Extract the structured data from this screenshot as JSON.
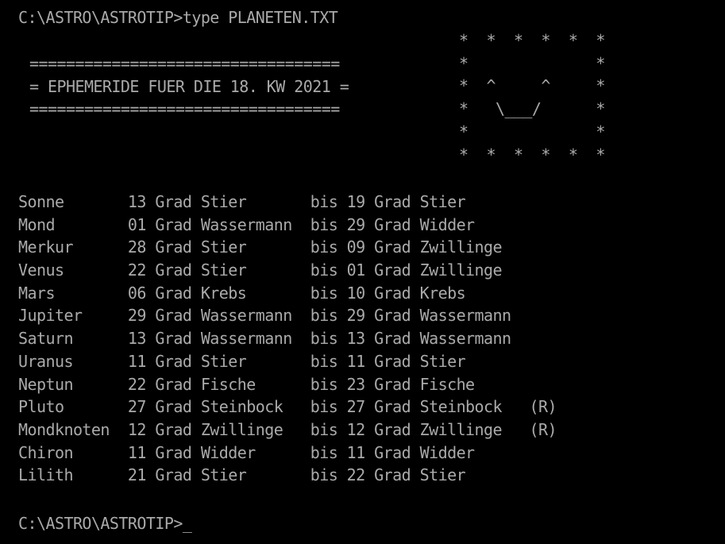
{
  "terminal": {
    "background_color": "#000000",
    "text_color": "#aaaaaa",
    "prompt_path": "C:\\ASTRO\\ASTROTIP>",
    "command_typed": "type PLANETEN.TXT",
    "command_line": "C:\\ASTRO\\ASTROTIP>type PLANETEN.TXT",
    "final_prompt": "C:\\ASTRO\\ASTROTIP>_",
    "cursor_glyph": "_"
  },
  "header": {
    "rule_top": "==================================",
    "title_line": "= EPHEMERIDE FUER DIE 18. KW 2021 =",
    "rule_bottom": "==================================",
    "title_text": "EPHEMERIDE FUER DIE 18. KW 2021",
    "calendar_week": "18",
    "year": "2021"
  },
  "ascii_art": {
    "name": "smiley-face-star-border",
    "lines": [
      "*  *  *  *  *  *",
      "*              *",
      "*  ^     ^     *",
      "*   \\___/      *",
      "*              *",
      "*  *  *  *  *  *"
    ],
    "eye_glyph": "^",
    "mouth_glyph": "\\___/",
    "star_glyph": "*"
  },
  "table": {
    "separator_word": "bis",
    "unit_word": "Grad",
    "retrograde_marker": "(R)",
    "rows": [
      {
        "body": "Sonne",
        "from_deg": "13",
        "from_unit": "Grad",
        "from_sign": "Stier",
        "sep": "bis",
        "to_deg": "19",
        "to_unit": "Grad",
        "to_sign": "Stier",
        "retro": ""
      },
      {
        "body": "Mond",
        "from_deg": "01",
        "from_unit": "Grad",
        "from_sign": "Wassermann",
        "sep": "bis",
        "to_deg": "29",
        "to_unit": "Grad",
        "to_sign": "Widder",
        "retro": ""
      },
      {
        "body": "Merkur",
        "from_deg": "28",
        "from_unit": "Grad",
        "from_sign": "Stier",
        "sep": "bis",
        "to_deg": "09",
        "to_unit": "Grad",
        "to_sign": "Zwillinge",
        "retro": ""
      },
      {
        "body": "Venus",
        "from_deg": "22",
        "from_unit": "Grad",
        "from_sign": "Stier",
        "sep": "bis",
        "to_deg": "01",
        "to_unit": "Grad",
        "to_sign": "Zwillinge",
        "retro": ""
      },
      {
        "body": "Mars",
        "from_deg": "06",
        "from_unit": "Grad",
        "from_sign": "Krebs",
        "sep": "bis",
        "to_deg": "10",
        "to_unit": "Grad",
        "to_sign": "Krebs",
        "retro": ""
      },
      {
        "body": "Jupiter",
        "from_deg": "29",
        "from_unit": "Grad",
        "from_sign": "Wassermann",
        "sep": "bis",
        "to_deg": "29",
        "to_unit": "Grad",
        "to_sign": "Wassermann",
        "retro": ""
      },
      {
        "body": "Saturn",
        "from_deg": "13",
        "from_unit": "Grad",
        "from_sign": "Wassermann",
        "sep": "bis",
        "to_deg": "13",
        "to_unit": "Grad",
        "to_sign": "Wassermann",
        "retro": ""
      },
      {
        "body": "Uranus",
        "from_deg": "11",
        "from_unit": "Grad",
        "from_sign": "Stier",
        "sep": "bis",
        "to_deg": "11",
        "to_unit": "Grad",
        "to_sign": "Stier",
        "retro": ""
      },
      {
        "body": "Neptun",
        "from_deg": "22",
        "from_unit": "Grad",
        "from_sign": "Fische",
        "sep": "bis",
        "to_deg": "23",
        "to_unit": "Grad",
        "to_sign": "Fische",
        "retro": ""
      },
      {
        "body": "Pluto",
        "from_deg": "27",
        "from_unit": "Grad",
        "from_sign": "Steinbock",
        "sep": "bis",
        "to_deg": "27",
        "to_unit": "Grad",
        "to_sign": "Steinbock",
        "retro": "(R)"
      },
      {
        "body": "Mondknoten",
        "from_deg": "12",
        "from_unit": "Grad",
        "from_sign": "Zwillinge",
        "sep": "bis",
        "to_deg": "12",
        "to_unit": "Grad",
        "to_sign": "Zwillinge",
        "retro": "(R)"
      },
      {
        "body": "Chiron",
        "from_deg": "11",
        "from_unit": "Grad",
        "from_sign": "Widder",
        "sep": "bis",
        "to_deg": "11",
        "to_unit": "Grad",
        "to_sign": "Widder",
        "retro": ""
      },
      {
        "body": "Lilith",
        "from_deg": "21",
        "from_unit": "Grad",
        "from_sign": "Stier",
        "sep": "bis",
        "to_deg": "22",
        "to_unit": "Grad",
        "to_sign": "Stier",
        "retro": ""
      }
    ]
  }
}
